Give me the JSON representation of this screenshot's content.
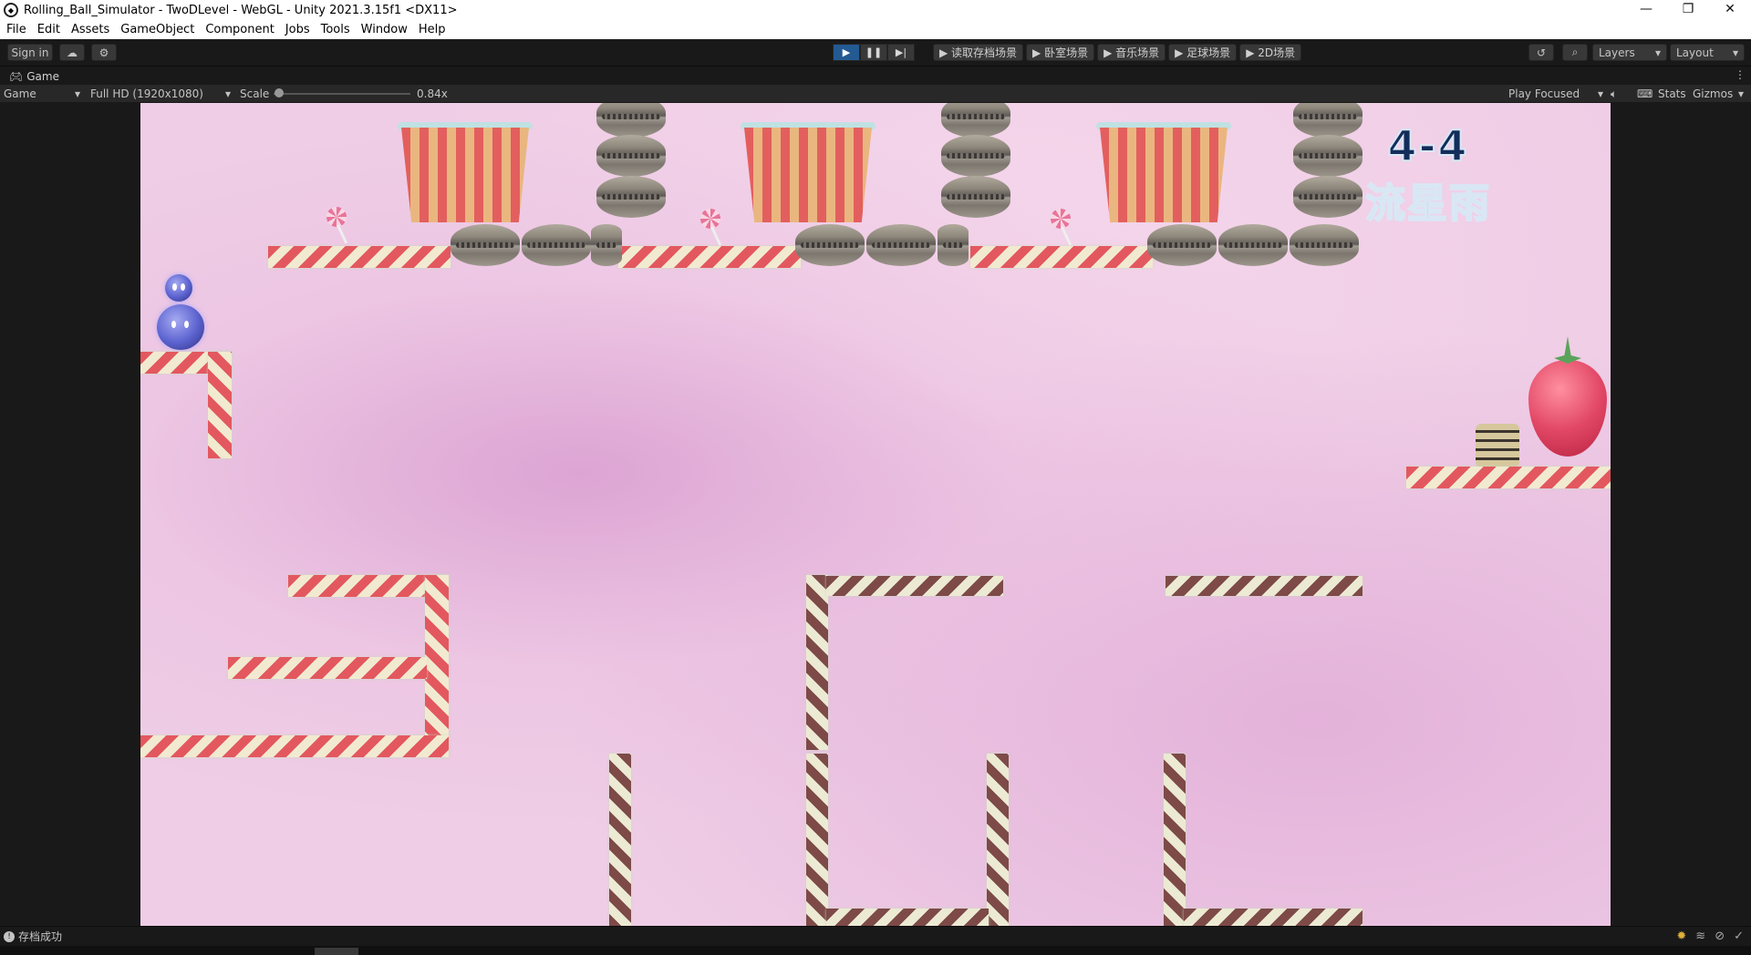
{
  "window": {
    "title": "Rolling_Ball_Simulator - TwoDLevel - WebGL - Unity 2021.3.15f1 <DX11>",
    "controls": [
      "—",
      "❐",
      "✕"
    ]
  },
  "menu": [
    "File",
    "Edit",
    "Assets",
    "GameObject",
    "Component",
    "Jobs",
    "Tools",
    "Window",
    "Help"
  ],
  "toolbar": {
    "sign_in": "Sign in",
    "scene_buttons": [
      "▶ 读取存档场景",
      "▶ 卧室场景",
      "▶ 音乐场景",
      "▶ 足球场景",
      "▶ 2D场景"
    ],
    "layers": "Layers",
    "layout": "Layout",
    "play_state": "playing"
  },
  "tab": {
    "label": "Game",
    "menu": "⋮"
  },
  "gamebar": {
    "display": "Game",
    "resolution": "Full HD (1920x1080)",
    "scale_label": "Scale",
    "scale_value": "0.84x",
    "scale_fraction": 0.0,
    "play_mode": "Play Focused",
    "stats": "Stats",
    "gizmos": "Gizmos"
  },
  "game": {
    "level_number": "4-4",
    "level_name": "流星雨"
  },
  "status": {
    "message": "存档成功"
  }
}
